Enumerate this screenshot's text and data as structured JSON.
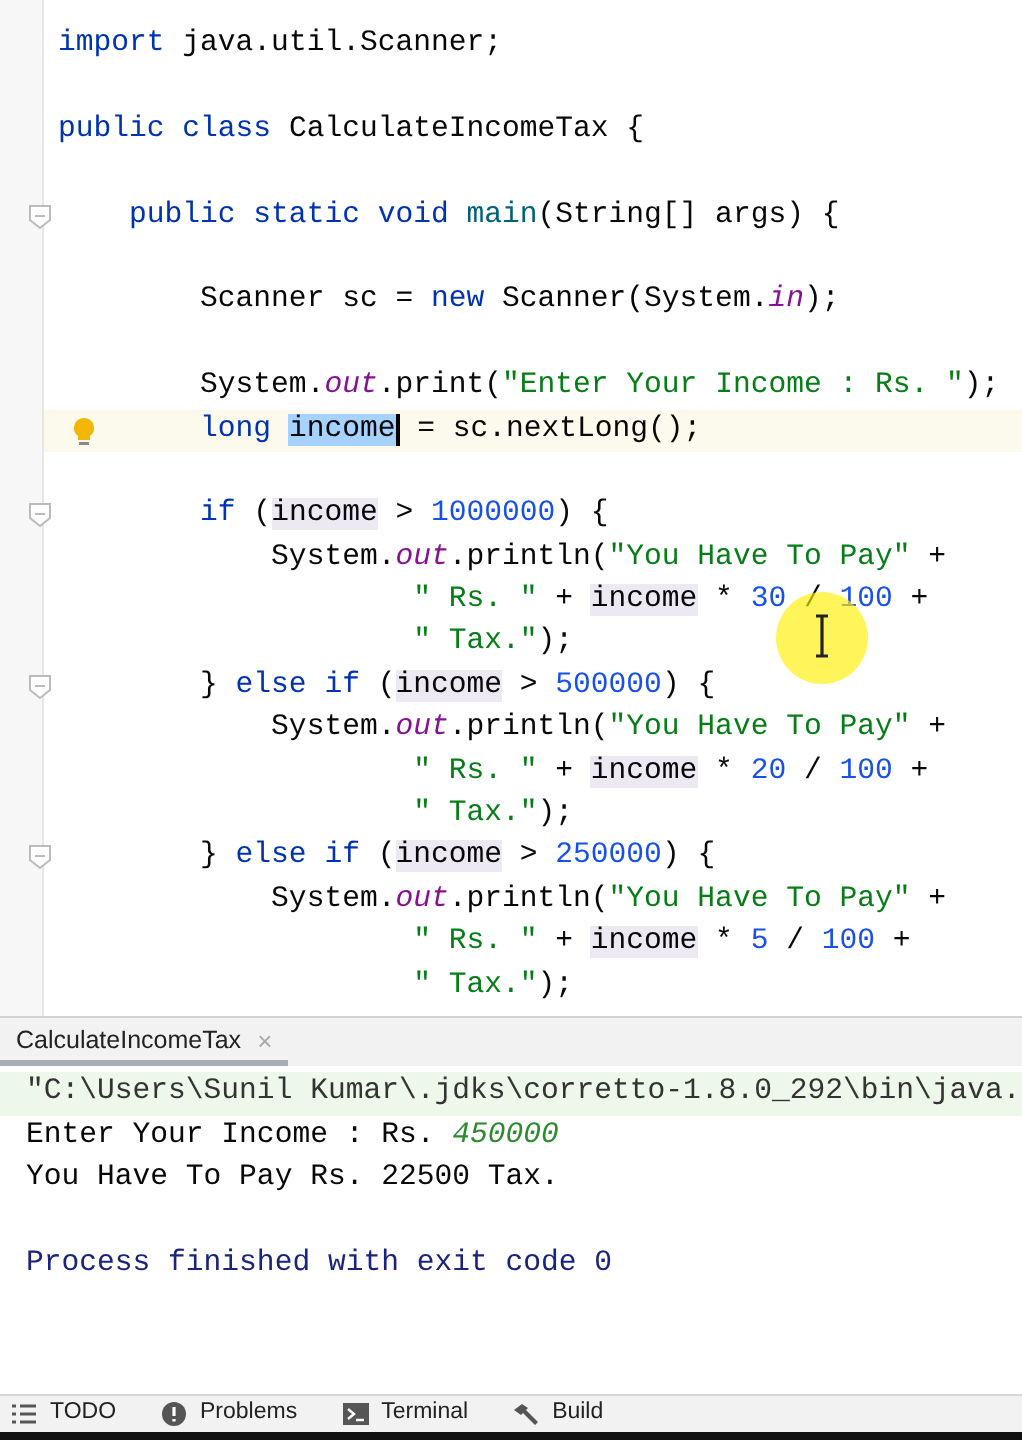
{
  "editor": {
    "lines": [
      {
        "kind": "code",
        "current": false,
        "tokens": [
          {
            "kind": "kw",
            "text": "import"
          },
          {
            "kind": "id",
            "text": " java.util.Scanner;"
          }
        ]
      },
      {
        "kind": "blank",
        "current": false
      },
      {
        "kind": "code",
        "current": false,
        "tokens": [
          {
            "kind": "kw",
            "text": "public class"
          },
          {
            "kind": "id",
            "text": " CalculateIncomeTax {"
          }
        ]
      },
      {
        "kind": "blank",
        "current": false
      },
      {
        "kind": "code",
        "current": false,
        "fold_marker": true,
        "tokens": [
          {
            "kind": "kw",
            "text": "    public static void"
          },
          {
            "kind": "fn",
            "text": " main"
          },
          {
            "kind": "id",
            "text": "(String[] args) {"
          }
        ]
      },
      {
        "kind": "blank",
        "current": false
      },
      {
        "kind": "code",
        "current": false,
        "tokens": [
          {
            "kind": "id",
            "text": "        Scanner sc = "
          },
          {
            "kind": "kw",
            "text": "new"
          },
          {
            "kind": "id",
            "text": " Scanner(System."
          },
          {
            "kind": "fld",
            "text": "in"
          },
          {
            "kind": "id",
            "text": ");"
          }
        ]
      },
      {
        "kind": "blank",
        "current": false
      },
      {
        "kind": "code",
        "current": false,
        "tokens": [
          {
            "kind": "id",
            "text": "        System."
          },
          {
            "kind": "fld",
            "text": "out"
          },
          {
            "kind": "id",
            "text": ".print("
          },
          {
            "kind": "str",
            "text": "\"Enter Your Income : Rs. \""
          },
          {
            "kind": "id",
            "text": ");"
          }
        ]
      },
      {
        "kind": "code",
        "current": true,
        "bulb": true,
        "tokens": [
          {
            "kind": "kw",
            "text": "        long "
          },
          {
            "kind": "sel",
            "text": "income"
          },
          {
            "kind": "id",
            "text": " = sc.nextLong();"
          }
        ]
      },
      {
        "kind": "blank",
        "current": false
      },
      {
        "kind": "code",
        "current": false,
        "fold_marker": true,
        "tokens": [
          {
            "kind": "kw",
            "text": "        if"
          },
          {
            "kind": "id",
            "text": " ("
          },
          {
            "kind": "use",
            "text": "income"
          },
          {
            "kind": "id",
            "text": " > "
          },
          {
            "kind": "num",
            "text": "1000000"
          },
          {
            "kind": "id",
            "text": ") {"
          }
        ]
      },
      {
        "kind": "code",
        "current": false,
        "tokens": [
          {
            "kind": "id",
            "text": "            System."
          },
          {
            "kind": "fld",
            "text": "out"
          },
          {
            "kind": "id",
            "text": ".println("
          },
          {
            "kind": "str",
            "text": "\"You Have To Pay\""
          },
          {
            "kind": "id",
            "text": " +"
          }
        ]
      },
      {
        "kind": "code",
        "current": false,
        "tokens": [
          {
            "kind": "str",
            "text": "                    \" Rs. \""
          },
          {
            "kind": "id",
            "text": " + "
          },
          {
            "kind": "use",
            "text": "income"
          },
          {
            "kind": "id",
            "text": " * "
          },
          {
            "kind": "num",
            "text": "30"
          },
          {
            "kind": "id",
            "text": " / "
          },
          {
            "kind": "num",
            "text": "100"
          },
          {
            "kind": "id",
            "text": " +"
          }
        ]
      },
      {
        "kind": "code",
        "current": false,
        "tokens": [
          {
            "kind": "str",
            "text": "                    \" Tax.\""
          },
          {
            "kind": "id",
            "text": ");"
          }
        ]
      },
      {
        "kind": "code",
        "current": false,
        "fold_marker": true,
        "tokens": [
          {
            "kind": "id",
            "text": "        } "
          },
          {
            "kind": "kw",
            "text": "else if"
          },
          {
            "kind": "id",
            "text": " ("
          },
          {
            "kind": "use",
            "text": "income"
          },
          {
            "kind": "id",
            "text": " > "
          },
          {
            "kind": "num",
            "text": "500000"
          },
          {
            "kind": "id",
            "text": ") {"
          }
        ]
      },
      {
        "kind": "code",
        "current": false,
        "tokens": [
          {
            "kind": "id",
            "text": "            System."
          },
          {
            "kind": "fld",
            "text": "out"
          },
          {
            "kind": "id",
            "text": ".println("
          },
          {
            "kind": "str",
            "text": "\"You Have To Pay\""
          },
          {
            "kind": "id",
            "text": " +"
          }
        ]
      },
      {
        "kind": "code",
        "current": false,
        "tokens": [
          {
            "kind": "str",
            "text": "                    \" Rs. \""
          },
          {
            "kind": "id",
            "text": " + "
          },
          {
            "kind": "use",
            "text": "income"
          },
          {
            "kind": "id",
            "text": " * "
          },
          {
            "kind": "num",
            "text": "20"
          },
          {
            "kind": "id",
            "text": " / "
          },
          {
            "kind": "num",
            "text": "100"
          },
          {
            "kind": "id",
            "text": " +"
          }
        ]
      },
      {
        "kind": "code",
        "current": false,
        "tokens": [
          {
            "kind": "str",
            "text": "                    \" Tax.\""
          },
          {
            "kind": "id",
            "text": ");"
          }
        ]
      },
      {
        "kind": "code",
        "current": false,
        "fold_marker": true,
        "tokens": [
          {
            "kind": "id",
            "text": "        } "
          },
          {
            "kind": "kw",
            "text": "else if"
          },
          {
            "kind": "id",
            "text": " ("
          },
          {
            "kind": "use",
            "text": "income"
          },
          {
            "kind": "id",
            "text": " > "
          },
          {
            "kind": "num",
            "text": "250000"
          },
          {
            "kind": "id",
            "text": ") {"
          }
        ]
      },
      {
        "kind": "code",
        "current": false,
        "tokens": [
          {
            "kind": "id",
            "text": "            System."
          },
          {
            "kind": "fld",
            "text": "out"
          },
          {
            "kind": "id",
            "text": ".println("
          },
          {
            "kind": "str",
            "text": "\"You Have To Pay\""
          },
          {
            "kind": "id",
            "text": " +"
          }
        ]
      },
      {
        "kind": "code",
        "current": false,
        "tokens": [
          {
            "kind": "str",
            "text": "                    \" Rs. \""
          },
          {
            "kind": "id",
            "text": " + "
          },
          {
            "kind": "use",
            "text": "income"
          },
          {
            "kind": "id",
            "text": " * "
          },
          {
            "kind": "num",
            "text": "5"
          },
          {
            "kind": "id",
            "text": " / "
          },
          {
            "kind": "num",
            "text": "100"
          },
          {
            "kind": "id",
            "text": " +"
          }
        ]
      },
      {
        "kind": "code",
        "current": false,
        "tokens": [
          {
            "kind": "str",
            "text": "                    \" Tax.\""
          },
          {
            "kind": "id",
            "text": ");"
          }
        ]
      }
    ]
  },
  "run_panel": {
    "tab": {
      "label": "CalculateIncomeTax",
      "close": "×",
      "selected": true
    },
    "console": [
      {
        "kind": "command",
        "parts": [
          {
            "kind": "cmd",
            "text": "\"C:\\Users\\Sunil Kumar\\.jdks\\corretto-1.8.0_292\\bin\\java."
          }
        ]
      },
      {
        "kind": "output",
        "parts": [
          {
            "kind": "out",
            "text": "Enter Your Income : Rs. "
          },
          {
            "kind": "input",
            "text": "450000"
          }
        ]
      },
      {
        "kind": "output",
        "parts": [
          {
            "kind": "out",
            "text": "You Have To Pay Rs. 22500 Tax."
          }
        ]
      },
      {
        "kind": "blank"
      },
      {
        "kind": "system",
        "parts": [
          {
            "kind": "sys",
            "text": "Process finished with exit code 0"
          }
        ]
      }
    ]
  },
  "tool_windows": [
    {
      "kind": "todo",
      "label": "TODO"
    },
    {
      "kind": "problems",
      "label": "Problems"
    },
    {
      "kind": "terminal",
      "label": "Terminal"
    },
    {
      "kind": "build",
      "label": "Build"
    }
  ]
}
